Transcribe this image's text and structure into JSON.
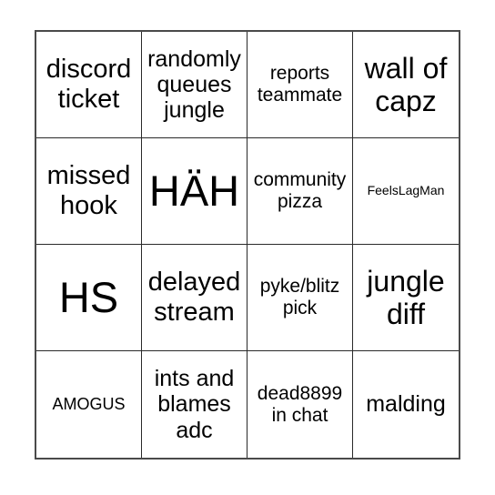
{
  "card": {
    "type": "bingo-card",
    "columns": 4,
    "rows": 4,
    "background_color": "#ffffff",
    "text_color": "#000000",
    "outer_border_color": "#4a4a4a",
    "inner_border_color": "#2a2a2a",
    "cells": [
      [
        {
          "text": "discord ticket",
          "size": "lg"
        },
        {
          "text": "randomly queues jungle",
          "size": "md"
        },
        {
          "text": "reports teammate",
          "size": "sm"
        },
        {
          "text": "wall of capz",
          "size": "xl"
        }
      ],
      [
        {
          "text": "missed hook",
          "size": "lg"
        },
        {
          "text": "HÄH",
          "size": "xxl"
        },
        {
          "text": "community pizza",
          "size": "sm"
        },
        {
          "text": "FeelsLagMan",
          "size": "xxs"
        }
      ],
      [
        {
          "text": "HS",
          "size": "xxl"
        },
        {
          "text": "delayed stream",
          "size": "lg"
        },
        {
          "text": "pyke/blitz pick",
          "size": "sm"
        },
        {
          "text": "jungle diff",
          "size": "xl"
        }
      ],
      [
        {
          "text": "AMOGUS",
          "size": "xs"
        },
        {
          "text": "ints and blames adc",
          "size": "md"
        },
        {
          "text": "dead8899 in chat",
          "size": "sm"
        },
        {
          "text": "malding",
          "size": "md"
        }
      ]
    ]
  }
}
